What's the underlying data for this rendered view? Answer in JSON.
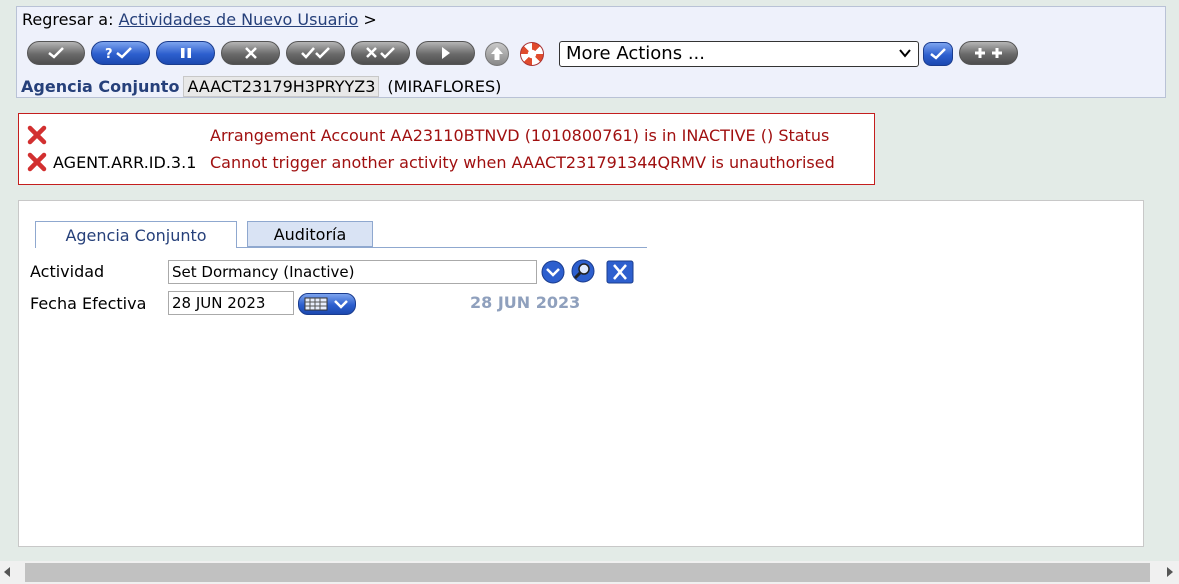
{
  "breadcrumb": {
    "prefix": "Regresar a:",
    "link": "Actividades de Nuevo Usuario",
    "separator": ">"
  },
  "toolbar": {
    "buttons": [
      {
        "icon": "commit-check-icon",
        "color": "gray"
      },
      {
        "icon": "validate-question-check-icon",
        "color": "blue"
      },
      {
        "icon": "hold-pause-icon",
        "color": "blue"
      },
      {
        "icon": "delete-x-icon",
        "color": "gray"
      },
      {
        "icon": "authorise-double-check-icon",
        "color": "gray"
      },
      {
        "icon": "reverse-x-check-icon",
        "color": "gray"
      },
      {
        "icon": "next-arrow-icon",
        "color": "gray"
      },
      {
        "icon": "upload-up-arrow-icon",
        "color": "gray"
      },
      {
        "icon": "help-lifebuoy-icon",
        "color": "red"
      }
    ],
    "more_actions": "More Actions ...",
    "go_icon": "go-check-icon",
    "add_icon": "add-plus-plus-icon"
  },
  "record": {
    "label": "Agencia Conjunto",
    "id": "AAACT23179H3PRYYZ3",
    "branch": "(MIRAFLORES)"
  },
  "errors": [
    {
      "field": "",
      "message": "Arrangement Account AA23110BTNVD (1010800761) is in INACTIVE () Status"
    },
    {
      "field": "AGENT.ARR.ID.3.1",
      "message": "Cannot trigger another activity when AAACT231791344QRMV is unauthorised"
    }
  ],
  "tabs": [
    {
      "label": "Agencia Conjunto",
      "active": true
    },
    {
      "label": "Auditoría",
      "active": false
    }
  ],
  "form": {
    "activity_label": "Actividad",
    "activity_value": "Set Dormancy (Inactive)",
    "date_label": "Fecha Efectiva",
    "date_value": "28 JUN 2023",
    "date_display": "28 JUN 2023"
  },
  "colors": {
    "error_border": "#c41e1e",
    "error_text": "#a01010",
    "link": "#26407a",
    "accent_blue": "#2d5fce"
  }
}
